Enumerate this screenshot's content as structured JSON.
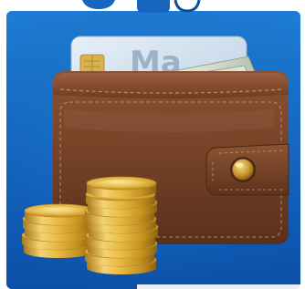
{
  "icon": {
    "name": "wallet-with-coins-icon",
    "background_color": "#1769c4",
    "wallet_color": "#7a4428",
    "coin_color": "#e2b94a",
    "card_color": "#d8e6f2",
    "card_text": "Ma"
  }
}
